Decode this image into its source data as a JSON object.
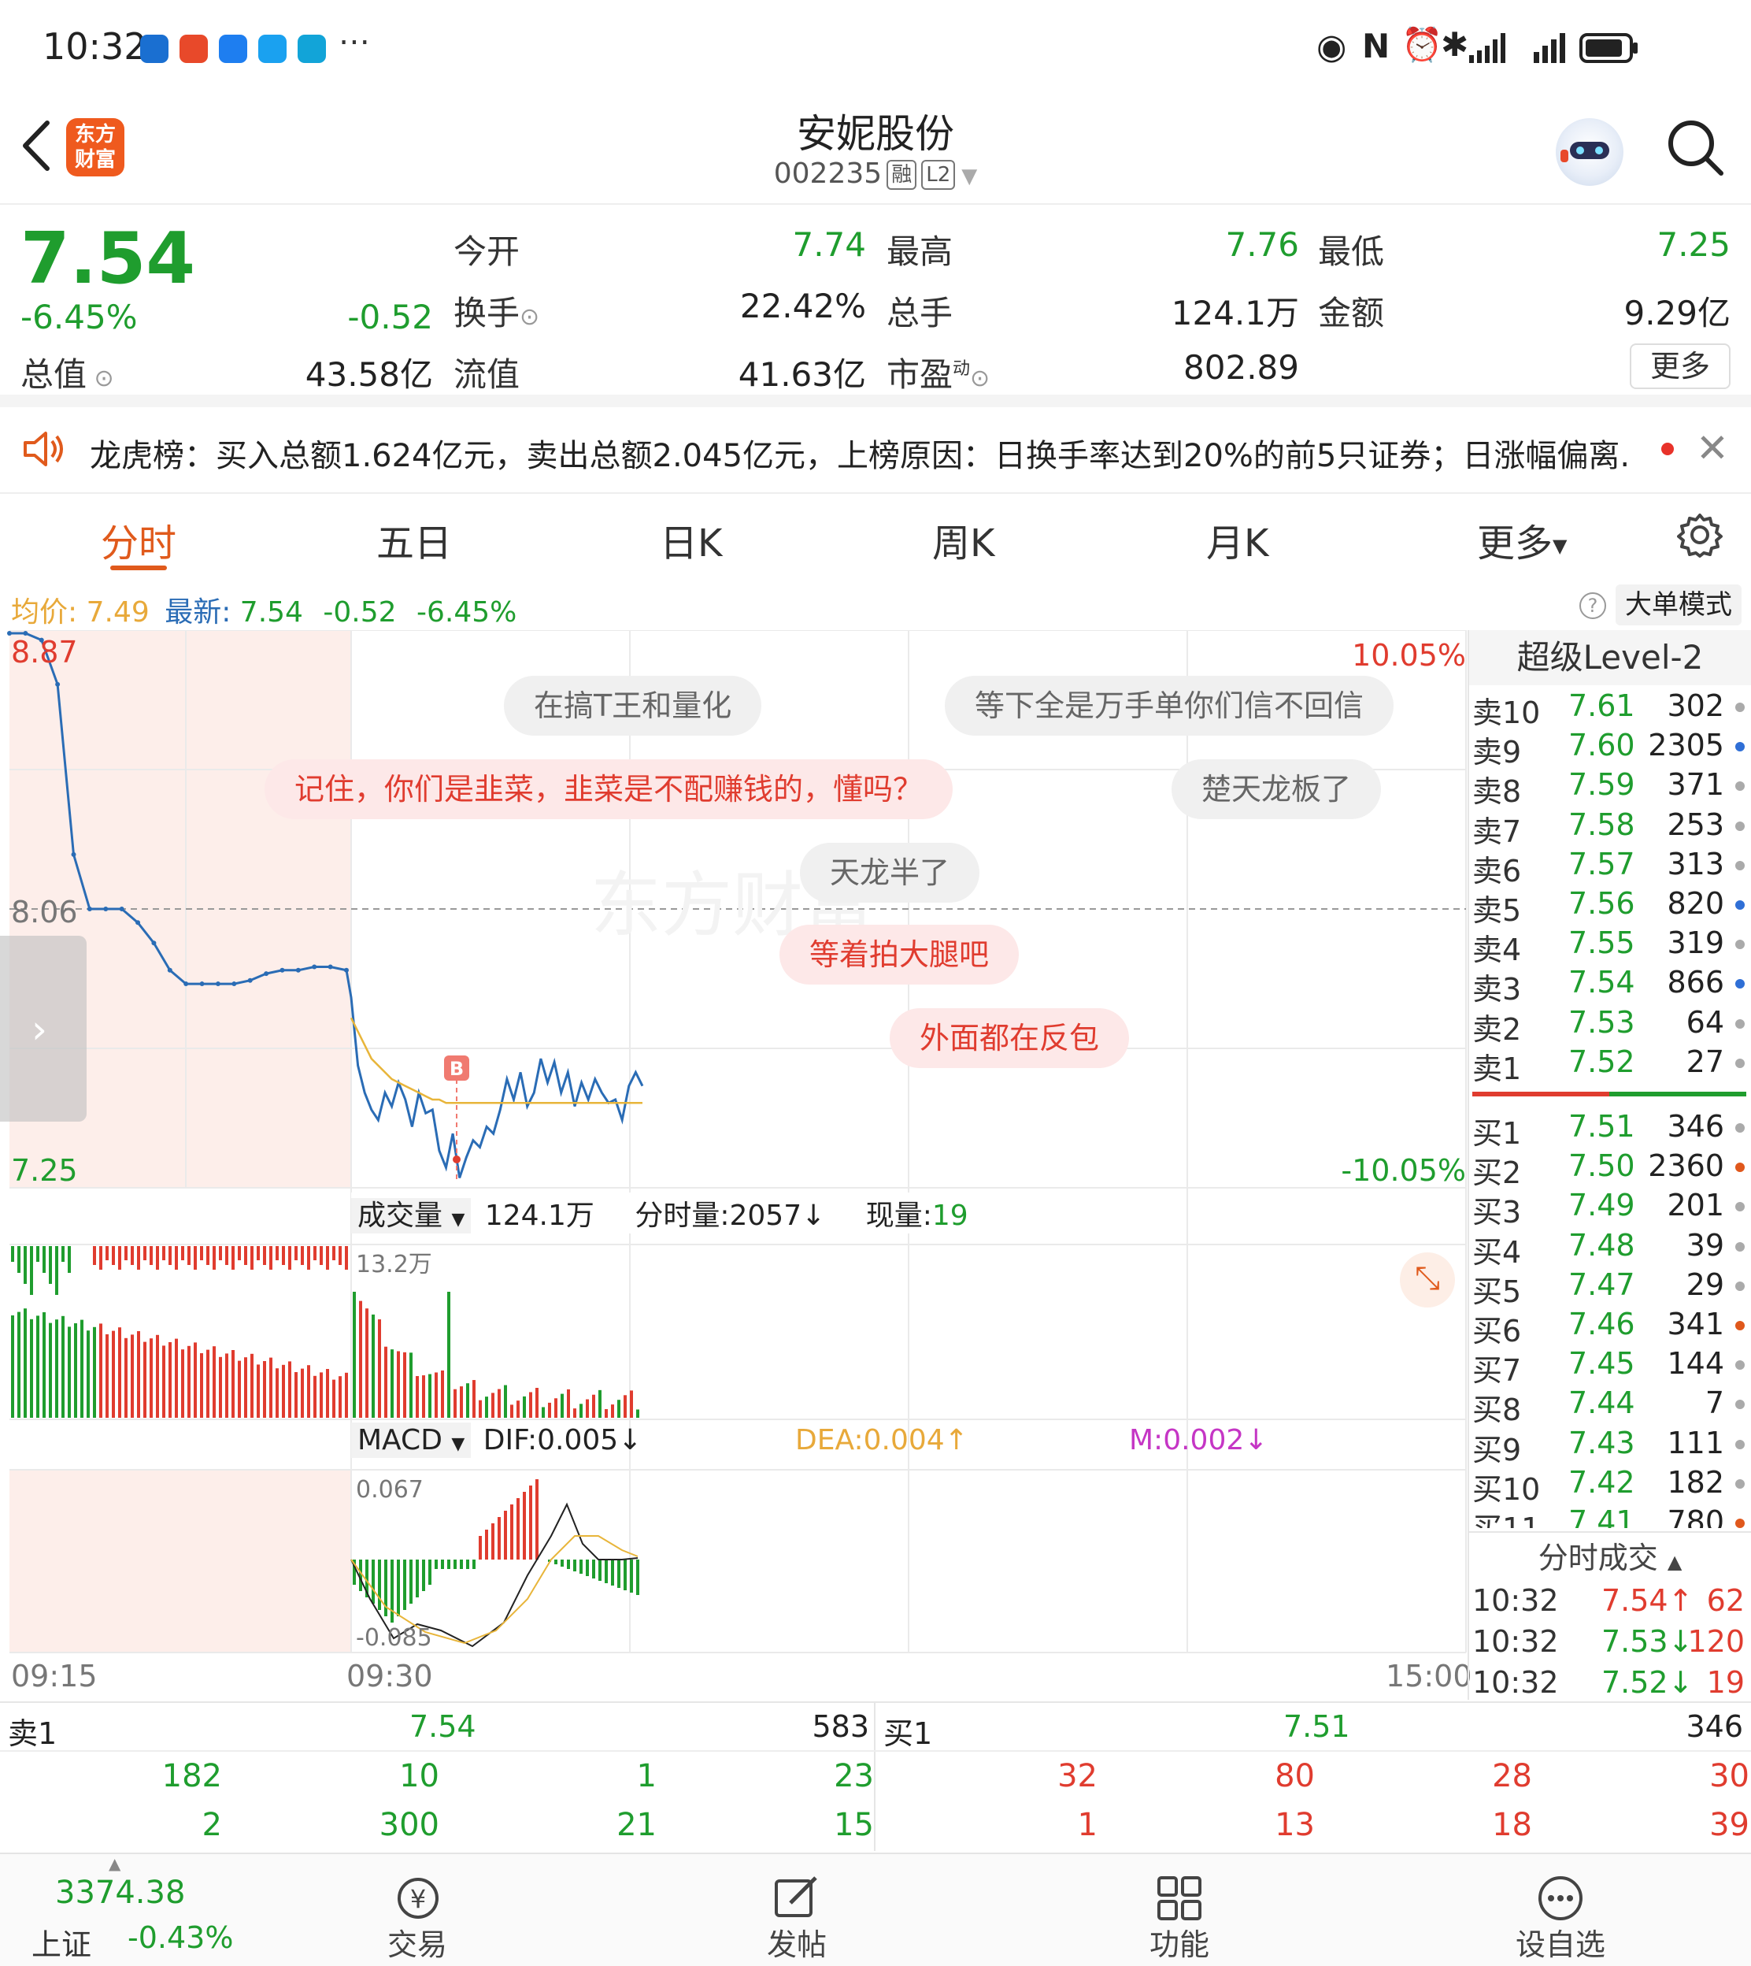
{
  "status_bar": {
    "time": "10:32",
    "icons": [
      "location-icon",
      "taobao-icon",
      "app-icon",
      "message-icon",
      "app2-icon",
      "more-icon",
      "eye-icon",
      "nfc-icon",
      "alarm-icon",
      "bluetooth-icon",
      "signal-icon",
      "signal2-icon",
      "battery-icon"
    ]
  },
  "header": {
    "back_icon": "back-arrow-icon",
    "logo_text_1": "东方",
    "logo_text_2": "财富",
    "title": "安妮股份",
    "code": "002235",
    "tag1": "融",
    "tag2": "L2",
    "search_icon": "search-icon"
  },
  "quote": {
    "price": "7.54",
    "change_pct": "-6.45%",
    "change": "-0.52",
    "open_label": "今开",
    "open": "7.74",
    "high_label": "最高",
    "high": "7.76",
    "low_label": "最低",
    "low": "7.25",
    "turnover_label": "换手",
    "turnover": "22.42%",
    "volume_label": "总手",
    "volume": "124.1万",
    "amount_label": "金额",
    "amount": "9.29亿",
    "mktcap_label": "总值",
    "mktcap": "43.58亿",
    "float_label": "流值",
    "float_cap": "41.63亿",
    "pe_label": "市盈",
    "pe_sup": "动",
    "pe": "802.89",
    "more_button": "更多"
  },
  "notice": {
    "text": "龙虎榜：买入总额1.624亿元，卖出总额2.045亿元，上榜原因：日换手率达到20%的前5只证券；日涨幅偏离..."
  },
  "tabs": [
    "分时",
    "五日",
    "日K",
    "周K",
    "月K",
    "更多"
  ],
  "chart_header": {
    "avg_label": "均价:",
    "avg": "7.49",
    "latest_label": "最新:",
    "latest": "7.54",
    "change": "-0.52",
    "change_pct": "-6.45%",
    "big_order_button": "大单模式"
  },
  "chart_labels": {
    "top_price": "8.87",
    "mid_price": "8.06",
    "bottom_price": "7.25",
    "top_pct": "10.05%",
    "bottom_pct": "-10.05%",
    "b_marker": "B",
    "vol_label": "成交量",
    "vol_total": "124.1万",
    "vol_tick": "分时量:2057↓",
    "vol_now_label": "现量:",
    "vol_now": "19",
    "vol_max": "13.2万",
    "macd_label": "MACD",
    "dif": "DIF:0.005↓",
    "dea": "DEA:0.004↑",
    "m": "M:0.002↓",
    "macd_top": "0.067",
    "macd_bottom": "-0.085",
    "time_start": "09:15",
    "time_open": "09:30",
    "time_end": "15:00"
  },
  "comments": [
    {
      "text": "在搞T王和量化",
      "style": "gray"
    },
    {
      "text": "等下全是万手单你们信不回信",
      "style": "gray"
    },
    {
      "text": "记住，你们是韭菜，韭菜是不配赚钱的，懂吗？",
      "style": "pink"
    },
    {
      "text": "楚天龙板了",
      "style": "gray"
    },
    {
      "text": "天龙半了",
      "style": "gray"
    },
    {
      "text": "等着拍大腿吧",
      "style": "pink"
    },
    {
      "text": "外面都在反包",
      "style": "pink"
    }
  ],
  "watermark": "东方财富",
  "orderbook": {
    "title": "超级Level-2",
    "asks": [
      {
        "label": "卖10",
        "price": "7.61",
        "vol": "302",
        "dot": "#aaaaaa"
      },
      {
        "label": "卖9",
        "price": "7.60",
        "vol": "2305",
        "dot": "#2f6fd6"
      },
      {
        "label": "卖8",
        "price": "7.59",
        "vol": "371",
        "dot": "#aaaaaa"
      },
      {
        "label": "卖7",
        "price": "7.58",
        "vol": "253",
        "dot": "#aaaaaa"
      },
      {
        "label": "卖6",
        "price": "7.57",
        "vol": "313",
        "dot": "#aaaaaa"
      },
      {
        "label": "卖5",
        "price": "7.56",
        "vol": "820",
        "dot": "#2f6fd6"
      },
      {
        "label": "卖4",
        "price": "7.55",
        "vol": "319",
        "dot": "#aaaaaa"
      },
      {
        "label": "卖3",
        "price": "7.54",
        "vol": "866",
        "dot": "#2f6fd6"
      },
      {
        "label": "卖2",
        "price": "7.53",
        "vol": "64",
        "dot": "#aaaaaa"
      },
      {
        "label": "卖1",
        "price": "7.52",
        "vol": "27",
        "dot": "#aaaaaa"
      }
    ],
    "bids": [
      {
        "label": "买1",
        "price": "7.51",
        "vol": "346",
        "dot": "#aaaaaa"
      },
      {
        "label": "买2",
        "price": "7.50",
        "vol": "2360",
        "dot": "#e0581c"
      },
      {
        "label": "买3",
        "price": "7.49",
        "vol": "201",
        "dot": "#aaaaaa"
      },
      {
        "label": "买4",
        "price": "7.48",
        "vol": "39",
        "dot": "#aaaaaa"
      },
      {
        "label": "买5",
        "price": "7.47",
        "vol": "29",
        "dot": "#aaaaaa"
      },
      {
        "label": "买6",
        "price": "7.46",
        "vol": "341",
        "dot": "#e0581c"
      },
      {
        "label": "买7",
        "price": "7.45",
        "vol": "144",
        "dot": "#aaaaaa"
      },
      {
        "label": "买8",
        "price": "7.44",
        "vol": "7",
        "dot": "#aaaaaa"
      },
      {
        "label": "买9",
        "price": "7.43",
        "vol": "111",
        "dot": "#aaaaaa"
      },
      {
        "label": "买10",
        "price": "7.42",
        "vol": "182",
        "dot": "#aaaaaa"
      },
      {
        "label": "买11",
        "price": "7.41",
        "vol": "780",
        "dot": "#e0581c"
      }
    ],
    "trades_title": "分时成交",
    "trades": [
      {
        "time": "10:32",
        "price": "7.54↑",
        "vol": "62",
        "dir": "up"
      },
      {
        "time": "10:32",
        "price": "7.53↓",
        "vol": "120",
        "dir": "down"
      },
      {
        "time": "10:32",
        "price": "7.52↓",
        "vol": "19",
        "dir": "down"
      }
    ]
  },
  "queue": {
    "sell_label": "卖1",
    "sell_price": "7.54",
    "sell_total": "583",
    "buy_label": "买1",
    "buy_price": "7.51",
    "buy_total": "346",
    "sell_row1": [
      "182",
      "10",
      "1",
      "23"
    ],
    "sell_row2": [
      "2",
      "300",
      "21",
      "15"
    ],
    "buy_row1": [
      "32",
      "80",
      "28",
      "30"
    ],
    "buy_row2": [
      "1",
      "13",
      "18",
      "39"
    ]
  },
  "bottom_nav": {
    "index_value": "3374.38",
    "index_name": "上证",
    "index_change": "-0.43%",
    "items": [
      {
        "label": "交易",
        "icon": "yuan-icon"
      },
      {
        "label": "发帖",
        "icon": "edit-icon"
      },
      {
        "label": "功能",
        "icon": "grid-icon"
      },
      {
        "label": "设自选",
        "icon": "more-dots-icon"
      }
    ]
  },
  "colors": {
    "up": "#e03c2f",
    "down": "#1f9d2e",
    "accent": "#e05a1c",
    "price_line": "#2a6cb5",
    "avg_line": "#e8b53a"
  },
  "chart_data": {
    "type": "line",
    "ylim": [
      7.25,
      8.87
    ],
    "pre_close": 8.06,
    "series": [
      {
        "values": [
          8.87,
          8.87,
          8.85,
          8.72,
          8.22,
          8.06,
          8.06,
          8.06,
          8.02,
          7.96,
          7.88,
          7.84,
          7.84,
          7.84,
          7.84,
          7.85,
          7.87,
          7.88,
          7.88,
          7.89,
          7.89,
          7.88,
          7.8,
          7.6,
          7.52,
          7.47,
          7.44,
          7.52,
          7.48,
          7.55,
          7.5,
          7.42,
          7.52,
          7.46,
          7.47,
          7.35,
          7.3,
          7.4,
          7.27,
          7.33,
          7.38,
          7.36,
          7.42,
          7.4,
          7.47,
          7.56,
          7.5,
          7.58,
          7.48,
          7.52,
          7.62,
          7.55,
          7.61,
          7.52,
          7.58,
          7.48,
          7.55,
          7.5,
          7.56,
          7.52,
          7.49,
          7.5,
          7.44,
          7.54,
          7.58,
          7.54
        ]
      },
      {
        "values": [
          7.74,
          7.7,
          7.66,
          7.62,
          7.6,
          7.58,
          7.56,
          7.55,
          7.54,
          7.53,
          7.52,
          7.51,
          7.5,
          7.5,
          7.49,
          7.49,
          7.49,
          7.49,
          7.49,
          7.49,
          7.49,
          7.49,
          7.49,
          7.49,
          7.49,
          7.49,
          7.49,
          7.49,
          7.49,
          7.49,
          7.49,
          7.49,
          7.49,
          7.49,
          7.49,
          7.49,
          7.49,
          7.49,
          7.49,
          7.49,
          7.49,
          7.49,
          7.49,
          7.49
        ]
      }
    ]
  }
}
